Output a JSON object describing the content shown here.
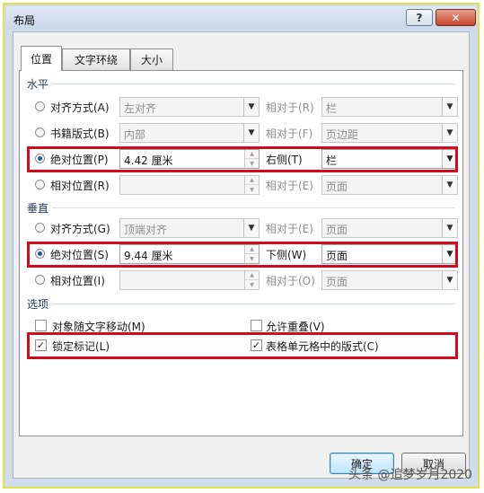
{
  "window": {
    "title": "布局",
    "help_label": "?",
    "close_label": "✕"
  },
  "tabs": [
    {
      "label": "位置",
      "active": true
    },
    {
      "label": "文字环绕",
      "active": false
    },
    {
      "label": "大小",
      "active": false
    }
  ],
  "horizontal": {
    "section_label": "水平",
    "alignment": {
      "label": "对齐方式(A)",
      "value": "左对齐",
      "relative_label": "相对于(R)",
      "relative_value": "栏"
    },
    "book_layout": {
      "label": "书籍版式(B)",
      "value": "内部",
      "relative_label": "相对于(F)",
      "relative_value": "页边距"
    },
    "absolute": {
      "label": "绝对位置(P)",
      "value": "4.42 厘米",
      "relative_label": "右侧(T)",
      "relative_value": "栏"
    },
    "relative": {
      "label": "相对位置(R)",
      "value": "",
      "relative_label": "相对于(E)",
      "relative_value": "页面"
    }
  },
  "vertical": {
    "section_label": "垂直",
    "alignment": {
      "label": "对齐方式(G)",
      "value": "顶端对齐",
      "relative_label": "相对于(E)",
      "relative_value": "页面"
    },
    "absolute": {
      "label": "绝对位置(S)",
      "value": "9.44 厘米",
      "relative_label": "下侧(W)",
      "relative_value": "页面"
    },
    "relative": {
      "label": "相对位置(I)",
      "value": "",
      "relative_label": "相对于(O)",
      "relative_value": "页面"
    }
  },
  "options": {
    "section_label": "选项",
    "move_with_text": {
      "label": "对象随文字移动(M)",
      "checked": false
    },
    "allow_overlap": {
      "label": "允许重叠(V)",
      "checked": false
    },
    "lock_anchor": {
      "label": "锁定标记(L)",
      "checked": true
    },
    "layout_in_cell": {
      "label": "表格单元格中的版式(C)",
      "checked": true
    }
  },
  "footer": {
    "ok_label": "确定",
    "cancel_label": "取消"
  },
  "watermark": "头条 @追梦岁月2020",
  "colors": {
    "highlight": "#d10a1c",
    "frame": "#e3e04a"
  }
}
